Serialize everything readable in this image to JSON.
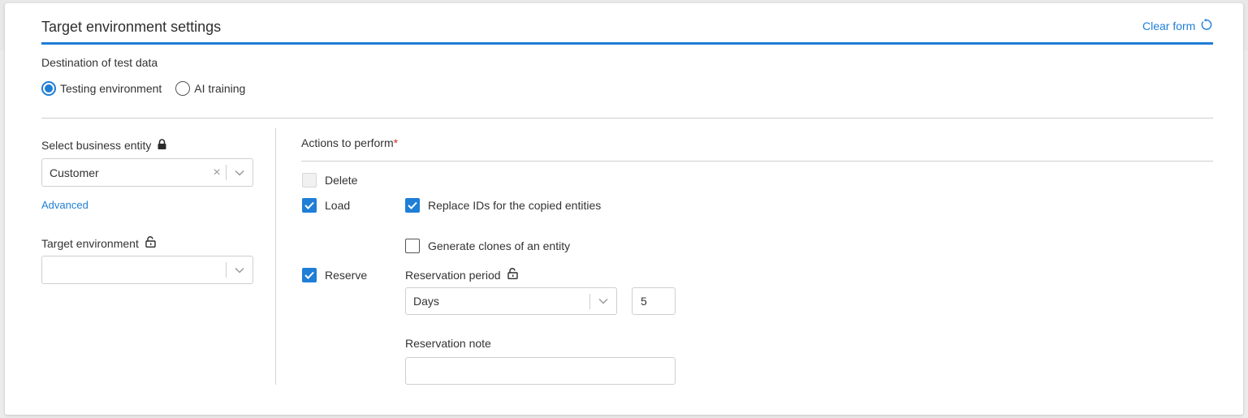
{
  "header": {
    "title": "Target environment settings",
    "clear_form_label": "Clear form"
  },
  "destination": {
    "label": "Destination of test data",
    "options": [
      {
        "label": "Testing environment",
        "selected": true
      },
      {
        "label": "AI training",
        "selected": false
      }
    ]
  },
  "left_panel": {
    "business_entity": {
      "label": "Select business entity",
      "value": "Customer"
    },
    "advanced_link": "Advanced",
    "target_environment": {
      "label": "Target environment",
      "value": ""
    }
  },
  "actions": {
    "label": "Actions to perform",
    "required_mark": "*",
    "delete": {
      "label": "Delete",
      "checked": false,
      "disabled": true
    },
    "load": {
      "label": "Load",
      "checked": true
    },
    "replace_ids": {
      "label": "Replace IDs for the copied entities",
      "checked": true
    },
    "generate_clones": {
      "label": "Generate clones of an entity",
      "checked": false
    },
    "reserve": {
      "label": "Reserve",
      "checked": true
    },
    "reservation_period": {
      "label": "Reservation period",
      "unit": "Days",
      "amount": "5"
    },
    "reservation_note": {
      "label": "Reservation note",
      "value": ""
    }
  },
  "colors": {
    "accent": "#1f7ed6",
    "required": "#d32f2f"
  }
}
